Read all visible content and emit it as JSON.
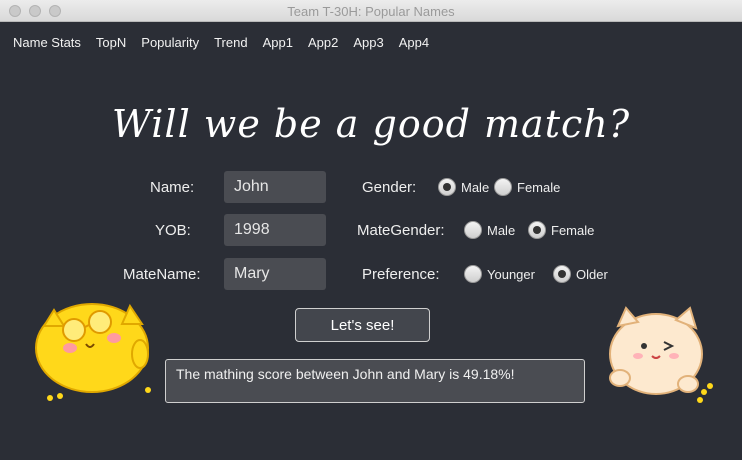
{
  "window": {
    "title": "Team T-30H: Popular Names"
  },
  "menu": [
    "Name Stats",
    "TopN",
    "Popularity",
    "Trend",
    "App1",
    "App2",
    "App3",
    "App4"
  ],
  "heading": "Will we be a good match?",
  "form": {
    "name_label": "Name:",
    "name_value": "John",
    "yob_label": "YOB:",
    "yob_value": "1998",
    "matename_label": "MateName:",
    "matename_value": "Mary",
    "gender_label": "Gender:",
    "gender_options": [
      "Male",
      "Female"
    ],
    "gender_selected": "Male",
    "mategender_label": "MateGender:",
    "mategender_options": [
      "Male",
      "Female"
    ],
    "mategender_selected": "Female",
    "preference_label": "Preference:",
    "preference_options": [
      "Younger",
      "Older"
    ],
    "preference_selected": "Older"
  },
  "button_label": "Let's see!",
  "result_text": "The mathing score between John and Mary is 49.18%!",
  "colors": {
    "background": "#2b2e36",
    "field": "#4a4c52",
    "mascot_left": "#ffd81a",
    "mascot_right": "#fde9cf"
  }
}
